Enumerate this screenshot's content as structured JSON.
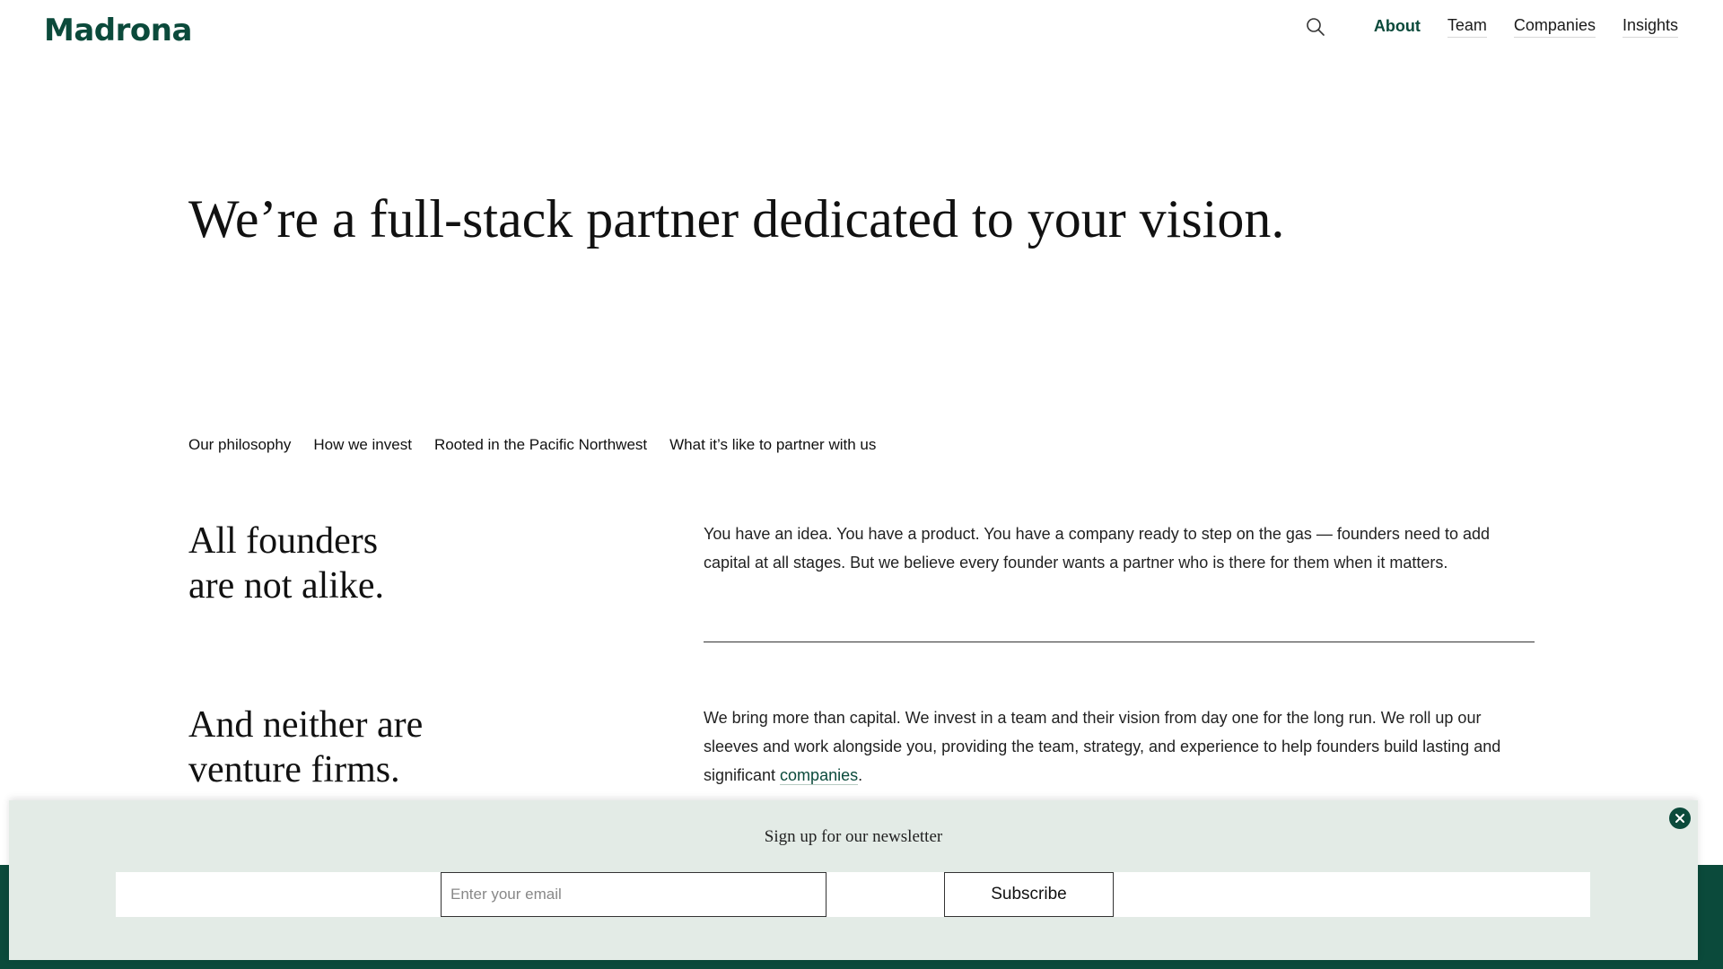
{
  "header": {
    "logo": "Madrona",
    "nav": [
      "About",
      "Team",
      "Companies",
      "Insights"
    ],
    "active_nav": "About"
  },
  "hero": {
    "title": "We’re a full-stack partner dedicated to your vision."
  },
  "tabs": [
    "Our philosophy",
    "How we invest",
    "Rooted in the Pacific Northwest",
    "What it’s like to partner with us"
  ],
  "sections": [
    {
      "heading_line1": "All founders",
      "heading_line2": "are not alike.",
      "body": "You have an idea. You have a product. You have a company ready to step on the gas — founders need to add capital at all stages. But we believe every founder wants a partner who is there for them when it matters."
    },
    {
      "heading_line1": "And neither are",
      "heading_line2": "venture firms.",
      "body": "We bring more than capital. We invest in a team and their vision from day one for the long run. We roll up our sleeves and work alongside you, providing the team, strategy, and experience to help founders build lasting and significant ",
      "link": "companies",
      "suffix": "."
    }
  ],
  "newsletter": {
    "title": "Sign up for our newsletter",
    "email_placeholder": "Enter your email",
    "email_value": "",
    "subscribe_label": "Subscribe"
  },
  "colors": {
    "brand": "#0b4a3b",
    "banner_bg": "#e3ebe6"
  },
  "icons": {
    "search": "search-icon",
    "close": "close-circle-icon"
  }
}
